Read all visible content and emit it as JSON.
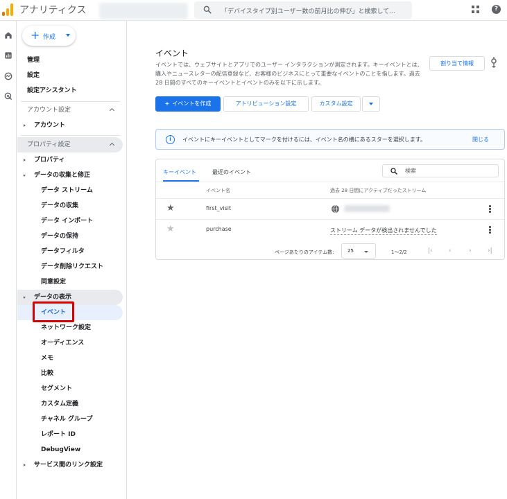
{
  "topbar": {
    "app_title": "アナリティクス",
    "search_placeholder": "「デバイスタイプ別ユーザー数の前月比の伸び」と検索して…",
    "help_glyph": "?"
  },
  "sidebar": {
    "create_label": "作成",
    "top_items": [
      "管理",
      "設定",
      "設定アシスタント"
    ],
    "account_section": "アカウント設定",
    "account_item": "アカウント",
    "property_section": "プロパティ設定",
    "property_item": "プロパティ",
    "collection_group": "データの収集と修正",
    "collection_items": [
      "データ ストリーム",
      "データの収集",
      "データ インポート",
      "データの保持",
      "データフィルタ",
      "データ削除リクエスト",
      "同意設定"
    ],
    "display_group": "データの表示",
    "display_items": [
      "イベント",
      "ネットワーク設定",
      "オーディエンス",
      "メモ",
      "比較",
      "セグメント",
      "カスタム定義",
      "チャネル グループ",
      "レポート ID",
      "DebugView"
    ],
    "service_links": "サービス間のリンク設定",
    "active_item": "イベント"
  },
  "main": {
    "title": "イベント",
    "description": "イベントでは、ウェブサイトとアプリでのユーザー インタラクションが測定されます。キーイベントとは、購入やニュースレターの配信登録など、お客様のビジネスにとって重要なイベントのことを指します。過去 28 日間のすべてのキーイベントとイベントのみを以下に示します。",
    "assign_info_label": "割り当て情報",
    "create_event_label": "イベントを作成",
    "attribution_label": "アトリビューション設定",
    "custom_settings_label": "カスタム設定",
    "info_message": "イベントにキーイベントとしてマークを付けるには、イベント名の横にあるスターを選択します。",
    "info_close": "閉じる",
    "tabs": [
      "キーイベント",
      "最近のイベント"
    ],
    "search_placeholder": "検索",
    "columns": [
      "イベント名",
      "過去 28 日間にアクティブだったストリーム"
    ],
    "rows": [
      {
        "name": "first_visit",
        "stream": "",
        "starred": true
      },
      {
        "name": "purchase",
        "stream": "ストリーム データが検出されませんでした",
        "starred": false
      }
    ],
    "pagination": {
      "items_per_page_label": "ページあたりのアイテム数:",
      "items_per_page": "25",
      "range": "1～2/2"
    }
  },
  "colors": {
    "accent": "#1a73e8",
    "highlight": "#d50000"
  },
  "icons": [
    "analytics-logo-icon",
    "search-icon",
    "apps-icon",
    "help-icon",
    "home-icon",
    "reports-icon",
    "explore-icon",
    "advertising-icon",
    "lightbulb-icon",
    "info-icon",
    "star-icon",
    "globe-icon",
    "more-vert-icon",
    "first-page-icon",
    "prev-page-icon",
    "next-page-icon",
    "last-page-icon"
  ]
}
